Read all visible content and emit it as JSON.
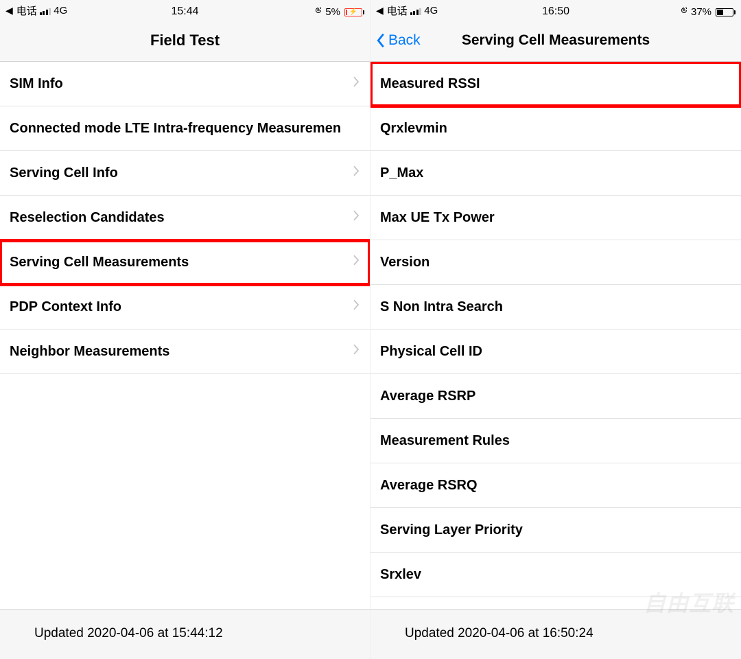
{
  "left": {
    "status": {
      "back_app": "电话",
      "network_label": "4G",
      "signal_level": 3,
      "time": "15:44",
      "lock": true,
      "battery_text": "5%",
      "battery_pct": 5,
      "battery_low": true,
      "battery_charging": true
    },
    "nav": {
      "title": "Field Test"
    },
    "rows": [
      {
        "label": "SIM Info",
        "chevron": true
      },
      {
        "label": "Connected mode LTE Intra-frequency Measuremen",
        "chevron": false
      },
      {
        "label": "Serving Cell Info",
        "chevron": true
      },
      {
        "label": "Reselection Candidates",
        "chevron": true
      },
      {
        "label": "Serving Cell Measurements",
        "chevron": true,
        "highlight": true
      },
      {
        "label": "PDP Context Info",
        "chevron": true
      },
      {
        "label": "Neighbor Measurements",
        "chevron": true
      }
    ],
    "footer": "Updated 2020-04-06 at 15:44:12"
  },
  "right": {
    "status": {
      "back_app": "电话",
      "network_label": "4G",
      "signal_level": 3,
      "time": "16:50",
      "lock": true,
      "battery_text": "37%",
      "battery_pct": 37,
      "battery_low": false,
      "battery_charging": false
    },
    "nav": {
      "back_label": "Back",
      "title": "Serving Cell Measurements"
    },
    "rows": [
      {
        "label": "Measured RSSI",
        "highlight": true
      },
      {
        "label": "Qrxlevmin"
      },
      {
        "label": "P_Max"
      },
      {
        "label": "Max UE Tx Power"
      },
      {
        "label": "Version"
      },
      {
        "label": "S Non Intra Search"
      },
      {
        "label": "Physical Cell ID"
      },
      {
        "label": "Average RSRP"
      },
      {
        "label": "Measurement Rules"
      },
      {
        "label": "Average RSRQ"
      },
      {
        "label": "Serving Layer Priority"
      },
      {
        "label": "Srxlev"
      }
    ],
    "footer": "Updated 2020-04-06 at 16:50:24"
  },
  "watermark": "自由互联"
}
